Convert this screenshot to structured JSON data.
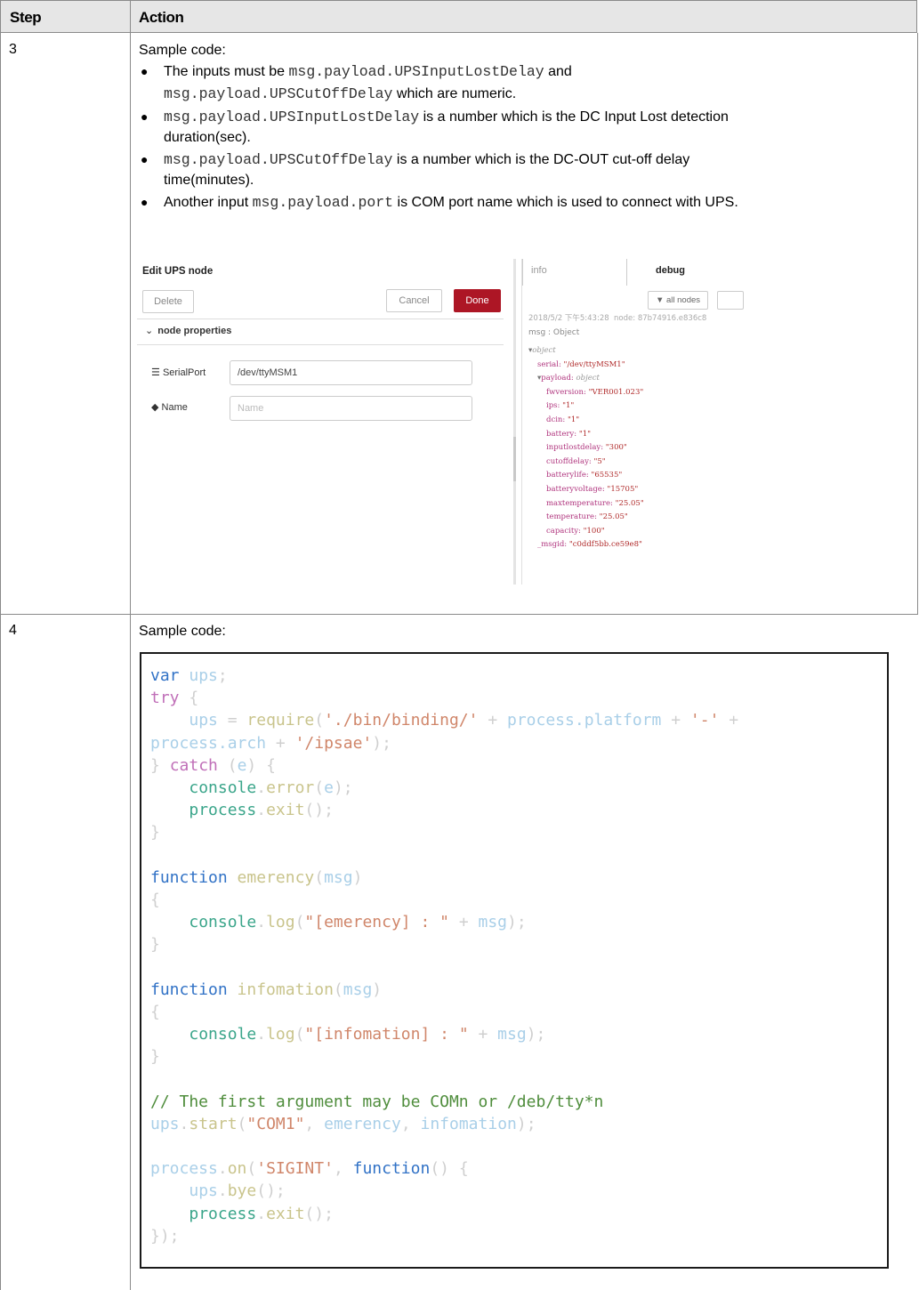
{
  "header": {
    "step": "Step",
    "action": "Action"
  },
  "rows": [
    {
      "step": "3",
      "intro": "Sample code:",
      "bullets": [
        {
          "a": "The inputs must be ",
          "c1": "msg.payload.UPSInputLostDelay",
          "b": " and",
          "c2": "msg.payload.UPSCutOffDelay",
          "d": " which are numeric."
        },
        {
          "c1": "msg.payload.UPSInputLostDelay",
          "a": " is a number which is the DC Input Lost detection",
          "b": "duration(sec)."
        },
        {
          "c1": "msg.payload.UPSCutOffDelay",
          "a": " is a number which is the DC-OUT cut-off delay",
          "b": "time(minutes)."
        },
        {
          "a": "Another input ",
          "c1": "msg.payload.port",
          "b": " is COM port name which is used to connect with UPS."
        }
      ]
    },
    {
      "step": "4",
      "intro": "Sample code:"
    }
  ],
  "screenshot": {
    "editor": {
      "title": "Edit UPS node",
      "delete": "Delete",
      "cancel": "Cancel",
      "done": "Done",
      "section": "node properties",
      "serialport_label": "SerialPort",
      "serialport_value": "/dev/ttyMSM1",
      "name_label": "Name",
      "name_placeholder": "Name"
    },
    "debug": {
      "tab_info": "info",
      "tab_debug": "debug",
      "filter": "all nodes",
      "meta": "2018/5/2 下午5:43:28  node: 87b74916.e836c8",
      "msg_label": "msg : Object",
      "lines": [
        {
          "k": "",
          "v": "object",
          "t": "o",
          "indent": 0,
          "arrow": "▾"
        },
        {
          "k": "serial: ",
          "v": "\"/dev/ttyMSM1\"",
          "t": "s",
          "indent": 1,
          "arrow": ""
        },
        {
          "k": "payload: ",
          "v": "object",
          "t": "o",
          "indent": 1,
          "arrow": "▾"
        },
        {
          "k": "fwversion: ",
          "v": "\"VER001.023\"",
          "t": "s",
          "indent": 2,
          "arrow": ""
        },
        {
          "k": "ips: ",
          "v": "\"1\"",
          "t": "s",
          "indent": 2,
          "arrow": ""
        },
        {
          "k": "dcin: ",
          "v": "\"1\"",
          "t": "s",
          "indent": 2,
          "arrow": ""
        },
        {
          "k": "battery: ",
          "v": "\"1\"",
          "t": "s",
          "indent": 2,
          "arrow": ""
        },
        {
          "k": "inputlostdelay: ",
          "v": "\"300\"",
          "t": "s",
          "indent": 2,
          "arrow": ""
        },
        {
          "k": "cutoffdelay: ",
          "v": "\"5\"",
          "t": "s",
          "indent": 2,
          "arrow": ""
        },
        {
          "k": "batterylife: ",
          "v": "\"65535\"",
          "t": "s",
          "indent": 2,
          "arrow": ""
        },
        {
          "k": "batteryvoltage: ",
          "v": "\"15705\"",
          "t": "s",
          "indent": 2,
          "arrow": ""
        },
        {
          "k": "maxtemperature: ",
          "v": "\"25.05\"",
          "t": "s",
          "indent": 2,
          "arrow": ""
        },
        {
          "k": "temperature: ",
          "v": "\"25.05\"",
          "t": "s",
          "indent": 2,
          "arrow": ""
        },
        {
          "k": "capacity: ",
          "v": "\"100\"",
          "t": "s",
          "indent": 2,
          "arrow": ""
        },
        {
          "k": "_msgid: ",
          "v": "\"c0ddf5bb.ce59e8\"",
          "t": "s",
          "indent": 1,
          "arrow": ""
        }
      ]
    }
  },
  "code_lines": [
    [
      [
        "kw",
        "var"
      ],
      [
        "pu",
        " "
      ],
      [
        "vr",
        "ups"
      ],
      [
        "pu",
        ";"
      ]
    ],
    [
      [
        "tc",
        "try"
      ],
      [
        "pu",
        " {"
      ]
    ],
    [
      [
        "pu",
        "    "
      ],
      [
        "vr",
        "ups"
      ],
      [
        "pu",
        " = "
      ],
      [
        "fn",
        "require"
      ],
      [
        "pu",
        "("
      ],
      [
        "st",
        "'./bin/binding/'"
      ],
      [
        "pu",
        " + "
      ],
      [
        "vr",
        "process.platform"
      ],
      [
        "pu",
        " + "
      ],
      [
        "st",
        "'-'"
      ],
      [
        "pu",
        " +"
      ]
    ],
    [
      [
        "vr",
        "process.arch"
      ],
      [
        "pu",
        " + "
      ],
      [
        "st",
        "'/ipsae'"
      ],
      [
        "pu",
        ");"
      ]
    ],
    [
      [
        "pu",
        "} "
      ],
      [
        "tc",
        "catch"
      ],
      [
        "pu",
        " ("
      ],
      [
        "vr",
        "e"
      ],
      [
        "pu",
        ") {"
      ]
    ],
    [
      [
        "pu",
        "    "
      ],
      [
        "mb",
        "console"
      ],
      [
        "pu",
        "."
      ],
      [
        "fn",
        "error"
      ],
      [
        "pu",
        "("
      ],
      [
        "vr",
        "e"
      ],
      [
        "pu",
        ");"
      ]
    ],
    [
      [
        "pu",
        "    "
      ],
      [
        "mb",
        "process"
      ],
      [
        "pu",
        "."
      ],
      [
        "fn",
        "exit"
      ],
      [
        "pu",
        "();"
      ]
    ],
    [
      [
        "pu",
        "}"
      ]
    ],
    [
      [
        "pu",
        ""
      ]
    ],
    [
      [
        "kw",
        "function"
      ],
      [
        "pu",
        " "
      ],
      [
        "fn",
        "emerency"
      ],
      [
        "pu",
        "("
      ],
      [
        "vr",
        "msg"
      ],
      [
        "pu",
        ")"
      ]
    ],
    [
      [
        "pu",
        "{"
      ]
    ],
    [
      [
        "pu",
        "    "
      ],
      [
        "mb",
        "console"
      ],
      [
        "pu",
        "."
      ],
      [
        "fn",
        "log"
      ],
      [
        "pu",
        "("
      ],
      [
        "st",
        "\"[emerency] : \""
      ],
      [
        "pu",
        " + "
      ],
      [
        "vr",
        "msg"
      ],
      [
        "pu",
        ");"
      ]
    ],
    [
      [
        "pu",
        "}"
      ]
    ],
    [
      [
        "pu",
        ""
      ]
    ],
    [
      [
        "kw",
        "function"
      ],
      [
        "pu",
        " "
      ],
      [
        "fn",
        "infomation"
      ],
      [
        "pu",
        "("
      ],
      [
        "vr",
        "msg"
      ],
      [
        "pu",
        ")"
      ]
    ],
    [
      [
        "pu",
        "{"
      ]
    ],
    [
      [
        "pu",
        "    "
      ],
      [
        "mb",
        "console"
      ],
      [
        "pu",
        "."
      ],
      [
        "fn",
        "log"
      ],
      [
        "pu",
        "("
      ],
      [
        "st",
        "\"[infomation] : \""
      ],
      [
        "pu",
        " + "
      ],
      [
        "vr",
        "msg"
      ],
      [
        "pu",
        ");"
      ]
    ],
    [
      [
        "pu",
        "}"
      ]
    ],
    [
      [
        "pu",
        ""
      ]
    ],
    [
      [
        "ct",
        "// The first argument may be COMn or /deb/tty*n"
      ]
    ],
    [
      [
        "vr",
        "ups"
      ],
      [
        "pu",
        "."
      ],
      [
        "fn",
        "start"
      ],
      [
        "pu",
        "("
      ],
      [
        "st",
        "\"COM1\""
      ],
      [
        "pu",
        ", "
      ],
      [
        "vr",
        "emerency"
      ],
      [
        "pu",
        ", "
      ],
      [
        "vr",
        "infomation"
      ],
      [
        "pu",
        ");"
      ]
    ],
    [
      [
        "pu",
        ""
      ]
    ],
    [
      [
        "vr",
        "process"
      ],
      [
        "pu",
        "."
      ],
      [
        "fn",
        "on"
      ],
      [
        "pu",
        "("
      ],
      [
        "st",
        "'SIGINT'"
      ],
      [
        "pu",
        ", "
      ],
      [
        "kw",
        "function"
      ],
      [
        "pu",
        "() {"
      ]
    ],
    [
      [
        "pu",
        "    "
      ],
      [
        "vr",
        "ups"
      ],
      [
        "pu",
        "."
      ],
      [
        "fn",
        "bye"
      ],
      [
        "pu",
        "();"
      ]
    ],
    [
      [
        "pu",
        "    "
      ],
      [
        "mb",
        "process"
      ],
      [
        "pu",
        "."
      ],
      [
        "fn",
        "exit"
      ],
      [
        "pu",
        "();"
      ]
    ],
    [
      [
        "pu",
        "});"
      ]
    ]
  ]
}
